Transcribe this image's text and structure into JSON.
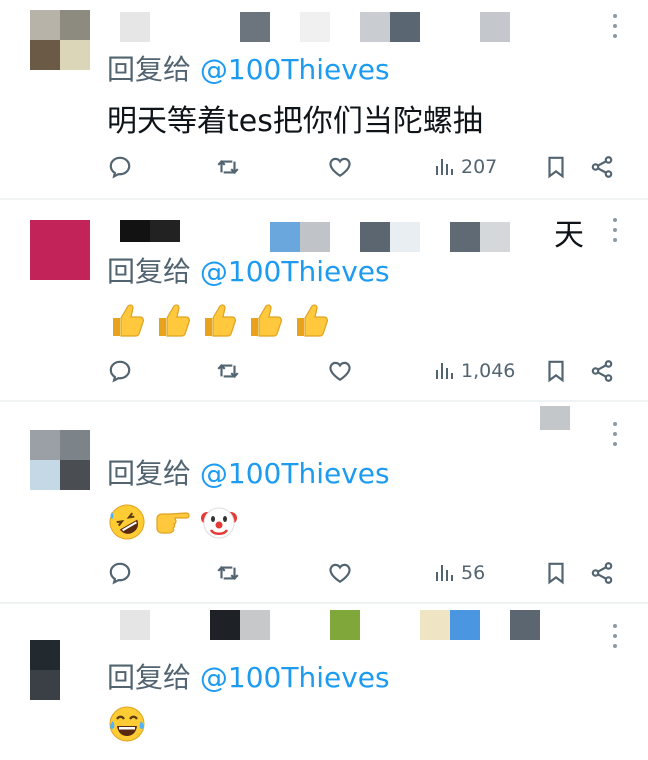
{
  "replies": [
    {
      "reply_prefix": "回复给 ",
      "handle": "@100Thieves",
      "text": "明天等着tes把你们当陀螺抽",
      "views": "207",
      "icons": [
        "reply-icon",
        "retweet-icon",
        "like-icon",
        "views-icon",
        "bookmark-icon",
        "share-icon"
      ]
    },
    {
      "reply_prefix": "回复给 ",
      "handle": "@100Thieves",
      "name_fragment": "天",
      "emojis": [
        "thumbs-up",
        "thumbs-up",
        "thumbs-up",
        "thumbs-up",
        "thumbs-up"
      ],
      "views": "1,046"
    },
    {
      "reply_prefix": "回复给 ",
      "handle": "@100Thieves",
      "emojis": [
        "rolling-on-floor-laughing",
        "pointing-right",
        "clown-face"
      ],
      "views": "56"
    },
    {
      "reply_prefix": "回复给 ",
      "handle": "@100Thieves",
      "emojis": [
        "face-with-tears-of-joy"
      ]
    }
  ],
  "colors": {
    "handle": "#1d9bf0",
    "muted": "#536471",
    "divider": "#eff3f4"
  }
}
